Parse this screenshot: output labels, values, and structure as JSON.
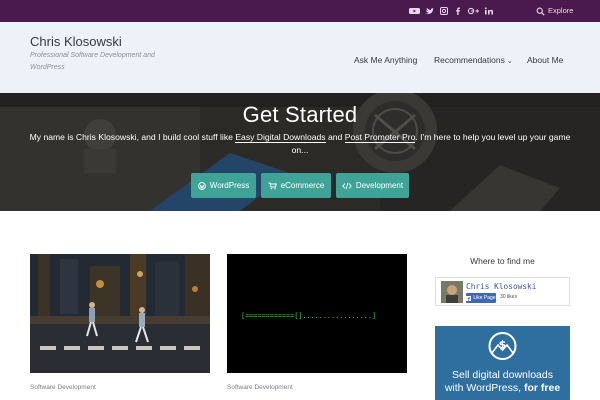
{
  "topbar": {
    "social_icons": [
      "youtube-icon",
      "twitter-icon",
      "instagram-icon",
      "facebook-icon",
      "google-plus-icon",
      "linkedin-icon"
    ],
    "explore_label": "Explore",
    "colors": {
      "background": "#4a1a4e",
      "icon": "#e6d8ea"
    }
  },
  "header": {
    "site_title": "Chris Klosowski",
    "tagline": "Professional Software Development and WordPress",
    "nav": [
      {
        "label": "Ask Me Anything"
      },
      {
        "label": "Recommendations"
      },
      {
        "label": "About Me"
      }
    ]
  },
  "hero": {
    "title": "Get Started",
    "text_pre": "My name is Chris Klosowski, and I build cool stuff like ",
    "link1": "Easy Digital Downloads",
    "text_mid": " and ",
    "link2": "Post Promoter Pro",
    "text_post": ". I'm here to help you level up your game on...",
    "buttons": [
      {
        "label": "WordPress",
        "icon": "wordpress-icon"
      },
      {
        "label": "eCommerce",
        "icon": "shopping-cart-icon"
      },
      {
        "label": "Development",
        "icon": "code-icon"
      }
    ],
    "colors": {
      "button": "#3fa398"
    }
  },
  "posts": [
    {
      "category": "Software Development",
      "image": "street-crossing-photo"
    },
    {
      "category": "Software Development",
      "image": "terminal-progress-bar",
      "terminal_text": "[============[].................]"
    }
  ],
  "sidebar": {
    "widget_title": "Where to find me",
    "facebook": {
      "name": "Chris Klosowski",
      "like_label": "Like Page",
      "likes": "30 likes"
    },
    "ad": {
      "line1": "Sell digital downloads",
      "line2_pre": "with WordPress, ",
      "line2_bold": "for free"
    }
  }
}
